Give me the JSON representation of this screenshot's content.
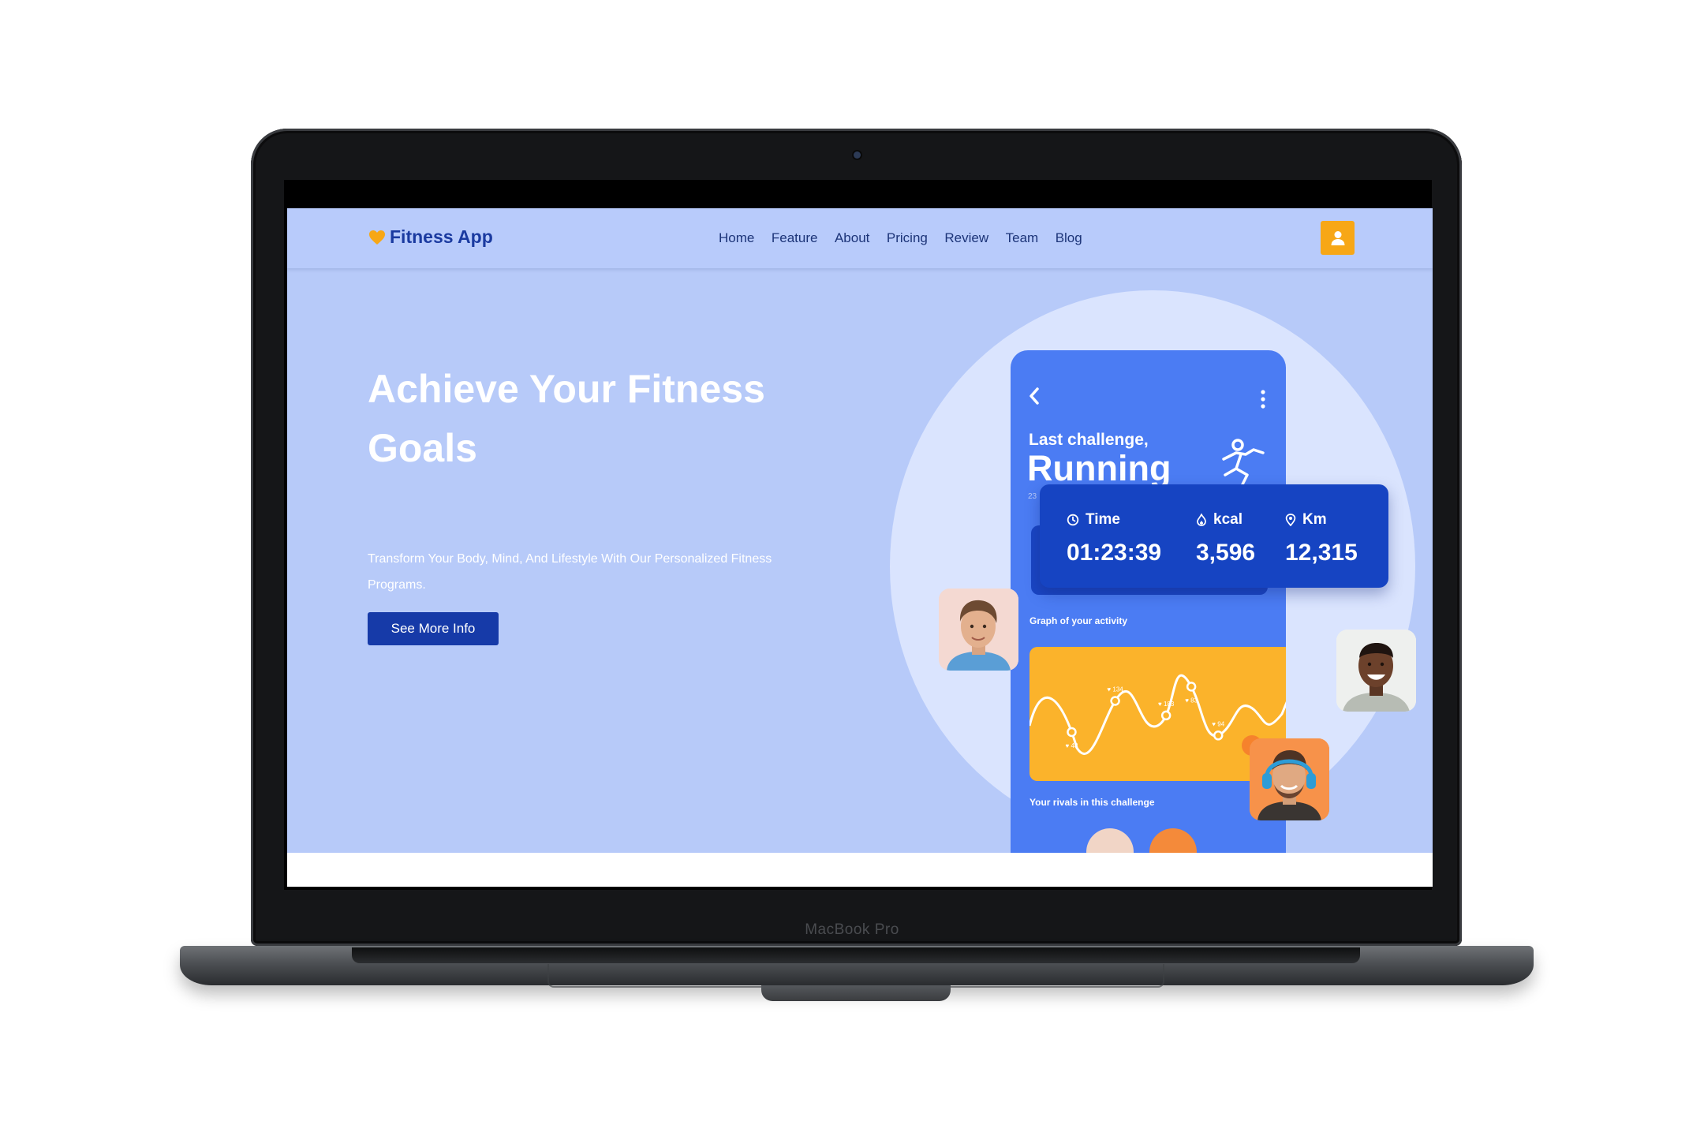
{
  "device": {
    "model_label": "MacBook Pro"
  },
  "site": {
    "brand": "Fitness App",
    "nav": [
      "Home",
      "Feature",
      "About",
      "Pricing",
      "Review",
      "Team",
      "Blog"
    ],
    "hero": {
      "title": "Achieve Your Fitness Goals",
      "subtitle": "Transform Your Body, Mind, And Lifestyle With Our Personalized Fitness Programs.",
      "cta": "See More Info"
    },
    "phone": {
      "challenge_label": "Last challenge,",
      "challenge_name": "Running",
      "date": "23",
      "graph_title": "Graph of your activity",
      "rivals_title": "Your rivals in this challenge",
      "graph_points": [
        {
          "label": "48"
        },
        {
          "label": "134"
        },
        {
          "label": "183"
        },
        {
          "label": "83"
        },
        {
          "label": "94"
        }
      ]
    },
    "stats": [
      {
        "label": "Time",
        "value": "01:23:39",
        "icon": "clock-icon"
      },
      {
        "label": "kcal",
        "value": "3,596",
        "icon": "flame-icon"
      },
      {
        "label": "Km",
        "value": "12,315",
        "icon": "location-pin-icon"
      }
    ]
  },
  "colors": {
    "hero_bg": "#b7caf9",
    "brand_blue": "#1a3aa0",
    "cta_blue": "#163aa8",
    "accent_orange": "#f7a716",
    "phone_blue": "#4b7cf3",
    "graph_yellow": "#fbb32b"
  }
}
